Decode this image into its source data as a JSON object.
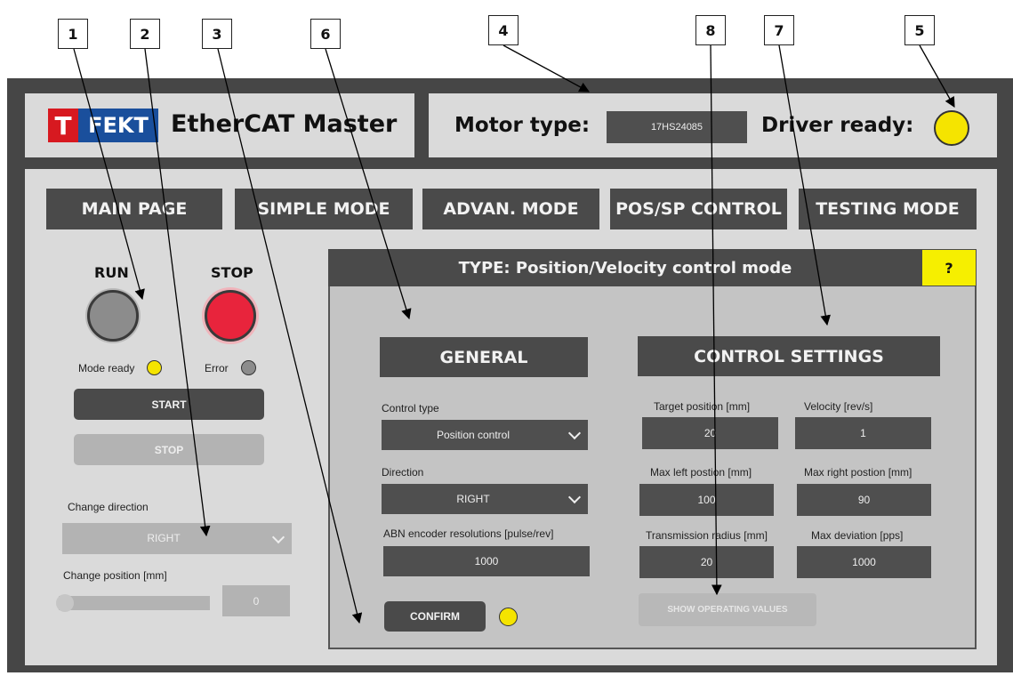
{
  "callouts": [
    "1",
    "2",
    "3",
    "6",
    "4",
    "8",
    "7",
    "5"
  ],
  "header": {
    "logo_letter": "T",
    "logo_text": "FEKT",
    "title": "EtherCAT Master",
    "motor_type_label": "Motor type:",
    "motor_type_value": "17HS24085",
    "driver_ready_label": "Driver ready:"
  },
  "nav": [
    "MAIN PAGE",
    "SIMPLE MODE",
    "ADVAN. MODE",
    "POS/SP CONTROL",
    "TESTING MODE"
  ],
  "left": {
    "run_label": "RUN",
    "stop_label": "STOP",
    "mode_ready_label": "Mode ready",
    "error_label": "Error",
    "start_button": "START",
    "stop_button": "STOP",
    "change_direction_label": "Change direction",
    "change_direction_value": "RIGHT",
    "change_position_label": "Change position [mm]",
    "change_position_value": "0"
  },
  "main": {
    "type_title": "TYPE: Position/Velocity control mode",
    "help": "?",
    "general_title": "GENERAL",
    "control_type_label": "Control type",
    "control_type_value": "Position control",
    "direction_label": "Direction",
    "direction_value": "RIGHT",
    "abn_label": "ABN encoder resolutions [pulse/rev]",
    "abn_value": "1000",
    "confirm": "CONFIRM",
    "control_settings_title": "CONTROL SETTINGS",
    "target_position_label": "Target position [mm]",
    "target_position_value": "20",
    "velocity_label": "Velocity [rev/s]",
    "velocity_value": "1",
    "max_left_label": "Max left postion [mm]",
    "max_left_value": "100",
    "max_right_label": "Max right postion [mm]",
    "max_right_value": "90",
    "transmission_label": "Transmission radius [mm]",
    "transmission_value": "20",
    "max_deviation_label": "Max deviation [pps]",
    "max_deviation_value": "1000",
    "show_operating_values": "SHOW OPERATING VALUES"
  },
  "colors": {
    "lamp_yellow": "#f5e400",
    "stop_red": "#e8243c",
    "logo_red": "#d71920",
    "logo_blue": "#1a4f9c",
    "help_yellow": "#f6ef00"
  }
}
